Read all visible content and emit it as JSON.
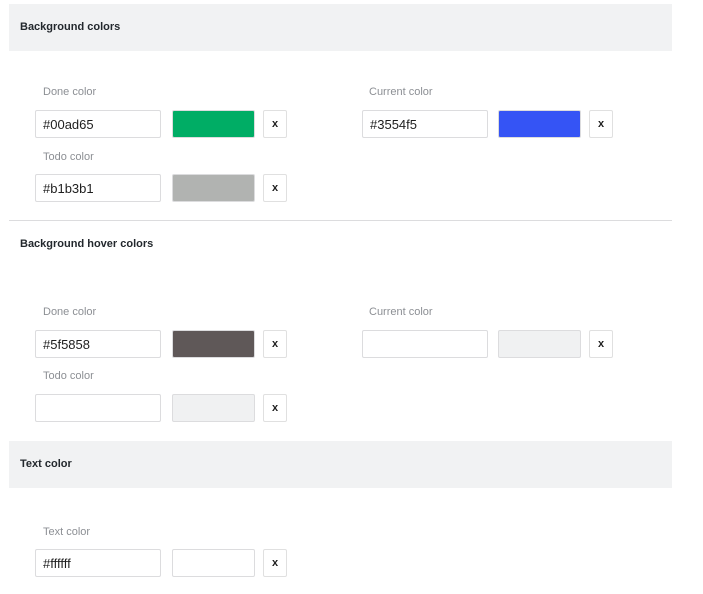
{
  "sections": {
    "background": {
      "title": "Background colors",
      "done": {
        "label": "Done color",
        "value": "#00ad65",
        "swatch": "#00ad65"
      },
      "current": {
        "label": "Current color",
        "value": "#3554f5",
        "swatch": "#3554f5"
      },
      "todo": {
        "label": "Todo color",
        "value": "#b1b3b1",
        "swatch": "#b1b3b1"
      }
    },
    "hover": {
      "title": "Background hover colors",
      "done": {
        "label": "Done color",
        "value": "#5f5858",
        "swatch": "#5f5858"
      },
      "current": {
        "label": "Current color",
        "value": "",
        "swatch": "#f0f1f2"
      },
      "todo": {
        "label": "Todo color",
        "value": "",
        "swatch": "#f0f1f2"
      }
    },
    "text": {
      "title": "Text color",
      "text": {
        "label": "Text color",
        "value": "#ffffff",
        "swatch": "#ffffff"
      }
    }
  },
  "clear_label": "x"
}
